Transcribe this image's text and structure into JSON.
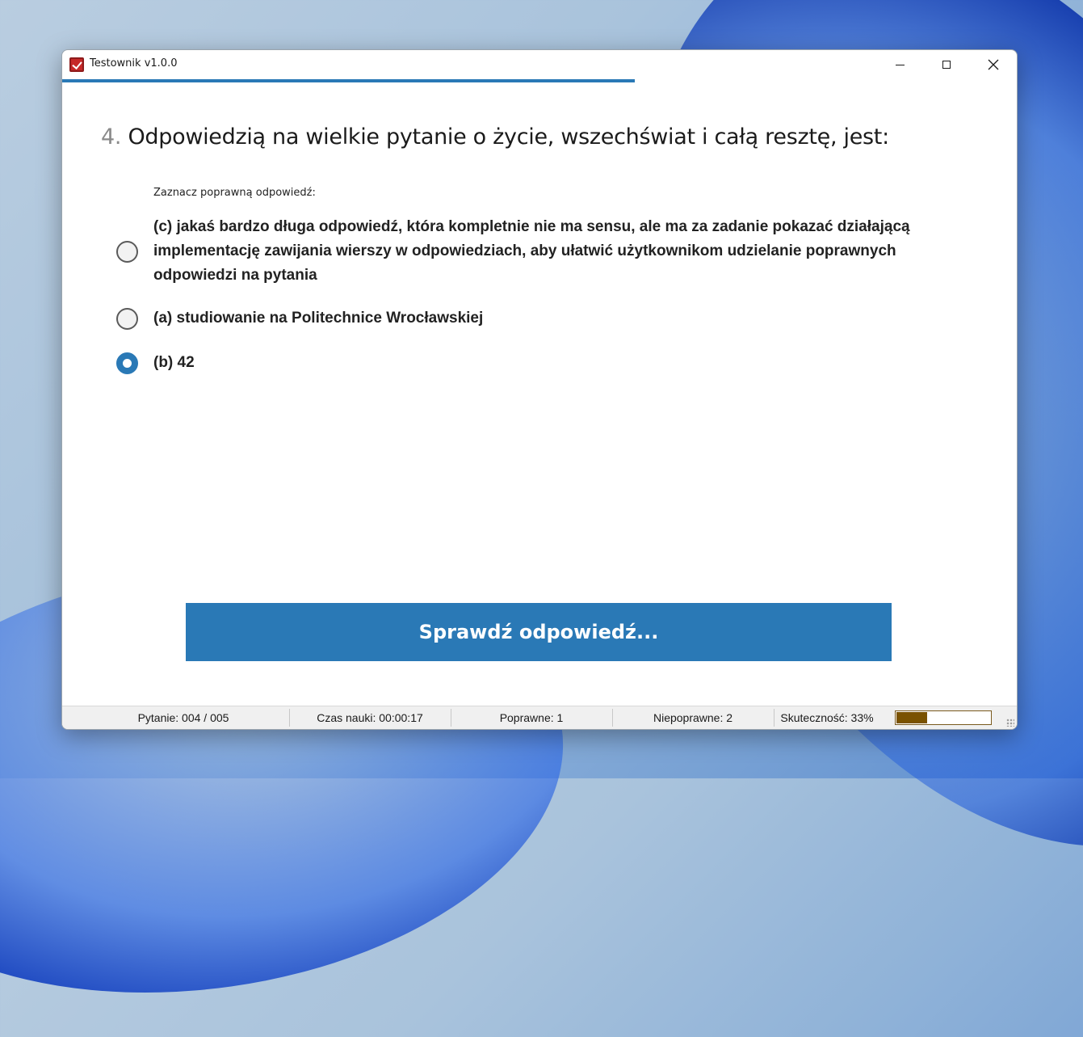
{
  "window": {
    "title": "Testownik v1.0.0"
  },
  "quiz": {
    "progress_fraction": 0.6,
    "question_number": "4.",
    "question_text": "Odpowiedzią na wielkie pytanie o życie, wszechświat i całą resztę, jest:",
    "instruction": "Zaznacz poprawną odpowiedź:",
    "answers": [
      {
        "label": "(c) jakaś bardzo długa odpowiedź, która kompletnie nie ma sensu, ale ma za zadanie pokazać działającą implementację zawijania wierszy w odpowiedziach, aby ułatwić użytkownikom udzielanie poprawnych odpowiedzi na pytania",
        "selected": false
      },
      {
        "label": "(a) studiowanie na Politechnice Wrocławskiej",
        "selected": false
      },
      {
        "label": "(b) 42",
        "selected": true
      }
    ],
    "check_button_label": "Sprawdź odpowiedź..."
  },
  "status": {
    "question": "Pytanie: 004 / 005",
    "time": "Czas nauki: 00:00:17",
    "correct": "Poprawne: 1",
    "incorrect": "Niepoprawne: 2",
    "effectiveness": "Skuteczność: 33%",
    "effectiveness_fraction": 0.33
  },
  "colors": {
    "accent": "#2a79b6",
    "effectiveness_bar": "#7a5200"
  }
}
